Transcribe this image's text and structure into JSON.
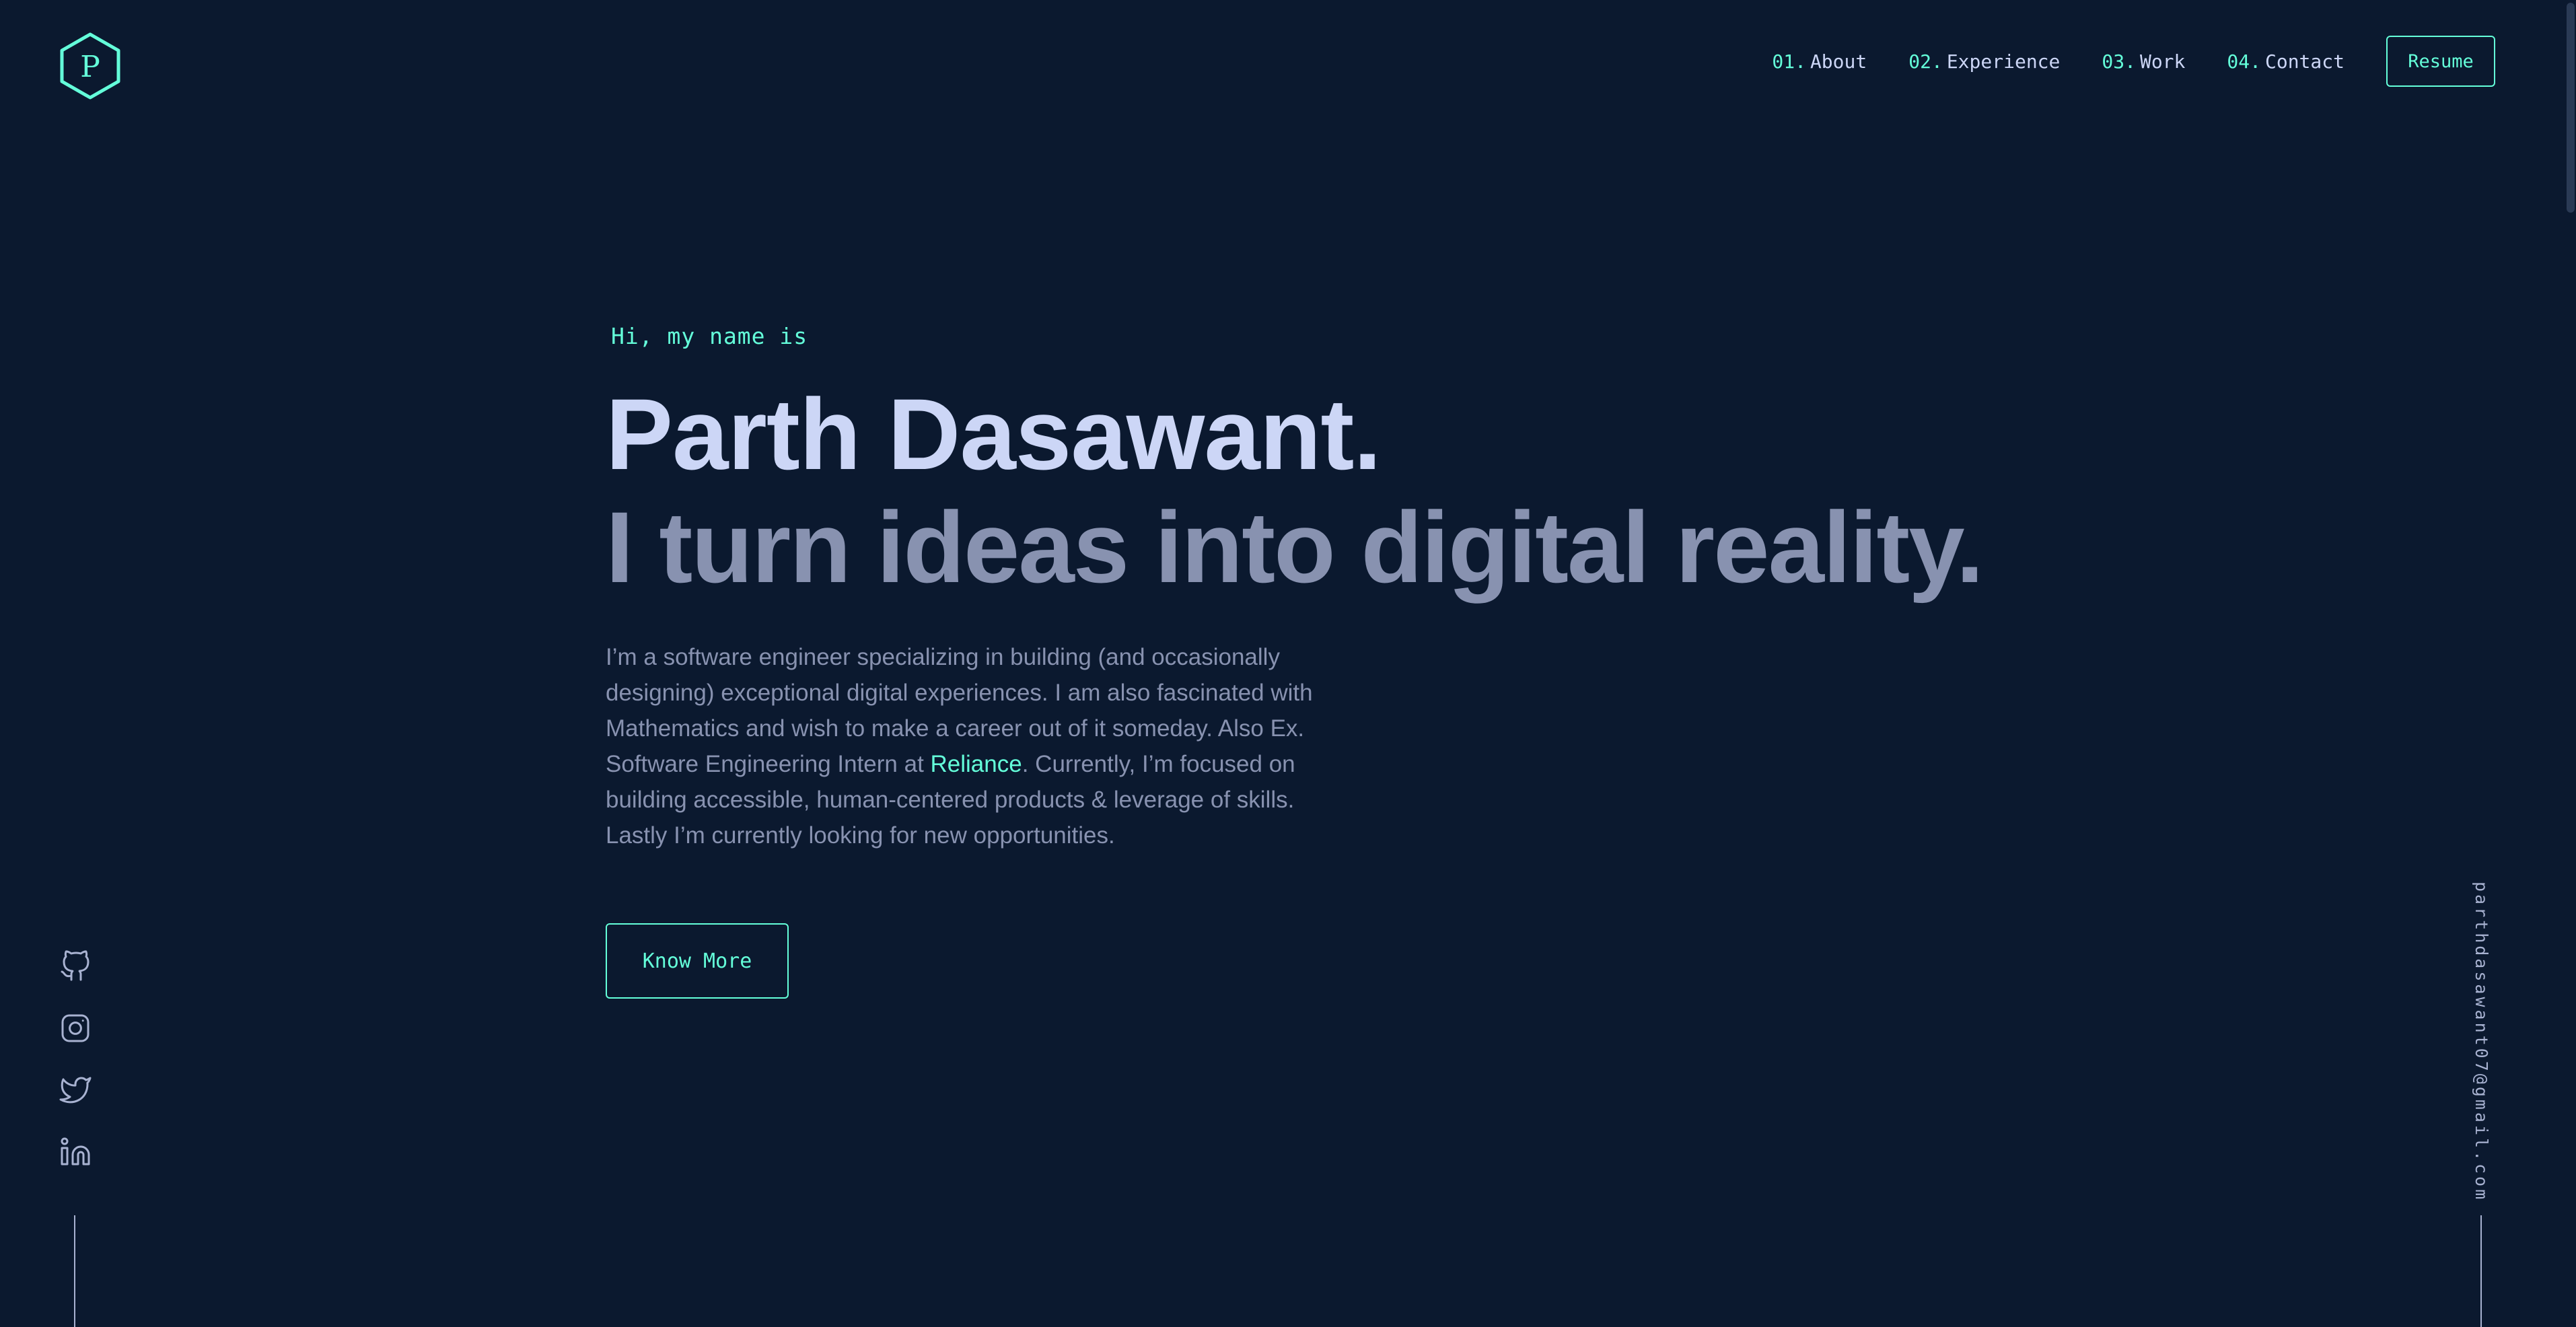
{
  "logo": {
    "letter": "P",
    "icon": "hexagon-logo-icon"
  },
  "nav": {
    "items": [
      {
        "num": "01.",
        "label": "About"
      },
      {
        "num": "02.",
        "label": "Experience"
      },
      {
        "num": "03.",
        "label": "Work"
      },
      {
        "num": "04.",
        "label": "Contact"
      }
    ],
    "resume_label": "Resume"
  },
  "hero": {
    "greeting": "Hi, my name is",
    "name": "Parth Dasawant.",
    "tagline": "I turn ideas into digital reality.",
    "bio_before": "I’m a software engineer specializing in building (and occasionally designing) exceptional digital experiences. I am also fascinated with Mathematics and wish to make a career out of it someday. Also Ex. Software Engineering Intern at ",
    "bio_link": "Reliance",
    "bio_after": ". Currently, I’m focused on building accessible, human-centered products & leverage of skills. Lastly I’m currently looking for new opportunities.",
    "cta_label": "Know More"
  },
  "socials": [
    "github-icon",
    "instagram-icon",
    "twitter-icon",
    "linkedin-icon"
  ],
  "email": "parthdasawant07@gmail.com",
  "colors": {
    "background": "#0b192f",
    "accent": "#64ffda",
    "heading": "#ccd6f6",
    "text": "#8892b0",
    "muted": "#a8b2d1"
  }
}
